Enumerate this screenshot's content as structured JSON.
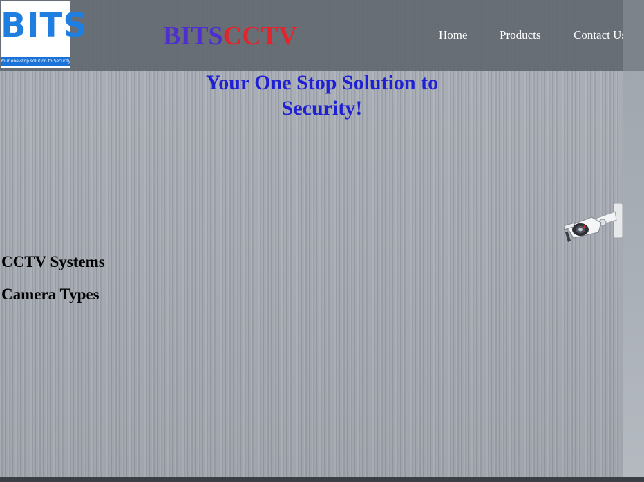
{
  "header": {
    "logo": {
      "text": "BITS",
      "tagline": "Your one-stop solution to Security"
    },
    "brand": {
      "part1": "BITS",
      "part2": "CCTV"
    },
    "nav": {
      "home": "Home",
      "products": "Products",
      "contact": "Contact Us"
    }
  },
  "hero": {
    "tagline": "Your One Stop Solution to Security!"
  },
  "side_links": {
    "cctv_systems": "CCTV Systems",
    "camera_types": "Camera Types"
  },
  "colors": {
    "brand_purple": "#4f2ed0",
    "brand_red": "#e0262c",
    "tagline_blue": "#1f1fd4",
    "header_bg": "#626870",
    "logo_blue": "#1e7fe0"
  },
  "icons": {
    "camera": "security-camera-icon"
  }
}
